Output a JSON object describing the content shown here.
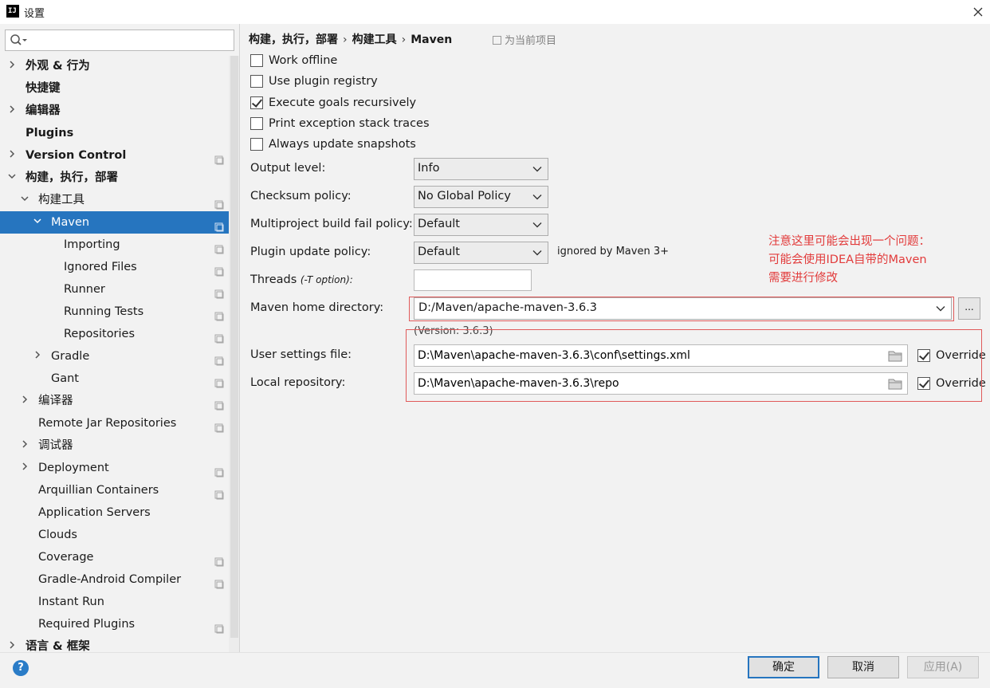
{
  "window": {
    "title": "设置",
    "app_icon": "IJ"
  },
  "search": {
    "placeholder": ""
  },
  "sidebar": {
    "items": [
      {
        "label": "外观 & 行为",
        "bold": true,
        "arrow": "right",
        "indent": 0,
        "project": false
      },
      {
        "label": "快捷键",
        "bold": true,
        "arrow": "",
        "indent": 0,
        "project": false
      },
      {
        "label": "编辑器",
        "bold": true,
        "arrow": "right",
        "indent": 0,
        "project": false
      },
      {
        "label": "Plugins",
        "bold": true,
        "arrow": "",
        "indent": 0,
        "project": false
      },
      {
        "label": "Version Control",
        "bold": true,
        "arrow": "right",
        "indent": 0,
        "project": true
      },
      {
        "label": "构建，执行，部署",
        "bold": true,
        "arrow": "down",
        "indent": 0,
        "project": false
      },
      {
        "label": "构建工具",
        "bold": false,
        "arrow": "down",
        "indent": 1,
        "project": true
      },
      {
        "label": "Maven",
        "bold": false,
        "arrow": "down",
        "indent": 2,
        "project": true,
        "selected": true
      },
      {
        "label": "Importing",
        "bold": false,
        "arrow": "",
        "indent": 3,
        "project": true
      },
      {
        "label": "Ignored Files",
        "bold": false,
        "arrow": "",
        "indent": 3,
        "project": true
      },
      {
        "label": "Runner",
        "bold": false,
        "arrow": "",
        "indent": 3,
        "project": true
      },
      {
        "label": "Running Tests",
        "bold": false,
        "arrow": "",
        "indent": 3,
        "project": true
      },
      {
        "label": "Repositories",
        "bold": false,
        "arrow": "",
        "indent": 3,
        "project": true
      },
      {
        "label": "Gradle",
        "bold": false,
        "arrow": "right",
        "indent": 2,
        "project": true
      },
      {
        "label": "Gant",
        "bold": false,
        "arrow": "",
        "indent": 2,
        "project": true
      },
      {
        "label": "编译器",
        "bold": false,
        "arrow": "right",
        "indent": 1,
        "project": true
      },
      {
        "label": "Remote Jar Repositories",
        "bold": false,
        "arrow": "",
        "indent": 1,
        "project": true
      },
      {
        "label": "调试器",
        "bold": false,
        "arrow": "right",
        "indent": 1,
        "project": false
      },
      {
        "label": "Deployment",
        "bold": false,
        "arrow": "right",
        "indent": 1,
        "project": true
      },
      {
        "label": "Arquillian Containers",
        "bold": false,
        "arrow": "",
        "indent": 1,
        "project": true
      },
      {
        "label": "Application Servers",
        "bold": false,
        "arrow": "",
        "indent": 1,
        "project": false
      },
      {
        "label": "Clouds",
        "bold": false,
        "arrow": "",
        "indent": 1,
        "project": false
      },
      {
        "label": "Coverage",
        "bold": false,
        "arrow": "",
        "indent": 1,
        "project": true
      },
      {
        "label": "Gradle-Android Compiler",
        "bold": false,
        "arrow": "",
        "indent": 1,
        "project": true
      },
      {
        "label": "Instant Run",
        "bold": false,
        "arrow": "",
        "indent": 1,
        "project": false
      },
      {
        "label": "Required Plugins",
        "bold": false,
        "arrow": "",
        "indent": 1,
        "project": true
      },
      {
        "label": "语言 & 框架",
        "bold": true,
        "arrow": "right",
        "indent": 0,
        "project": false
      }
    ]
  },
  "breadcrumb": {
    "part1": "构建，执行，部署",
    "part2": "构建工具",
    "part3": "Maven",
    "sep": "›"
  },
  "for_current_project": "为当前项目",
  "checkboxes": [
    {
      "label": "Work offline",
      "checked": false
    },
    {
      "label": "Use plugin registry",
      "checked": false
    },
    {
      "label": "Execute goals recursively",
      "checked": true
    },
    {
      "label": "Print exception stack traces",
      "checked": false
    },
    {
      "label": "Always update snapshots",
      "checked": false
    }
  ],
  "form": {
    "output_level_label": "Output level:",
    "output_level_value": "Info",
    "checksum_label": "Checksum policy:",
    "checksum_value": "No Global Policy",
    "multiproject_label": "Multiproject build fail policy:",
    "multiproject_value": "Default",
    "plugin_update_label": "Plugin update policy:",
    "plugin_update_value": "Default",
    "ignored_note": "ignored by Maven 3+",
    "threads_label": "Threads",
    "threads_hint": "(-T option):",
    "threads_value": "",
    "home_label": "Maven home directory:",
    "home_value": "D:/Maven/apache-maven-3.6.3",
    "browse_label": "...",
    "version": "(Version: 3.6.3)",
    "user_settings_label": "User settings file:",
    "user_settings_value": "D:\\Maven\\apache-maven-3.6.3\\conf\\settings.xml",
    "user_settings_override": true,
    "local_repo_label": "Local repository:",
    "local_repo_value": "D:\\Maven\\apache-maven-3.6.3\\repo",
    "local_repo_override": true,
    "override_label": "Override"
  },
  "annotation": {
    "line1": "注意这里可能会出现一个问题：",
    "line2": "可能会使用IDEA自带的Maven",
    "line3": "需要进行修改",
    "color": "#e23b3b"
  },
  "footer": {
    "help": "?",
    "ok": "确定",
    "cancel": "取消",
    "apply": "应用(A)"
  },
  "colors": {
    "selection": "#2675bf",
    "accent": "#2675bf"
  }
}
